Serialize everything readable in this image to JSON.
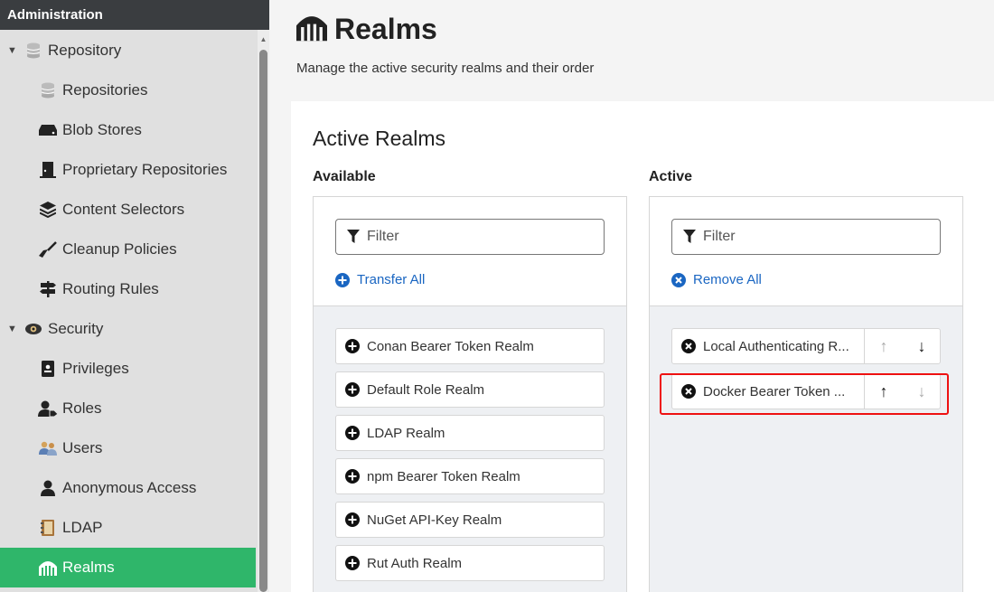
{
  "sidebar": {
    "header": "Administration",
    "repository": {
      "label": "Repository",
      "items": [
        "Repositories",
        "Blob Stores",
        "Proprietary Repositories",
        "Content Selectors",
        "Cleanup Policies",
        "Routing Rules"
      ]
    },
    "security": {
      "label": "Security",
      "items": [
        "Privileges",
        "Roles",
        "Users",
        "Anonymous Access",
        "LDAP",
        "Realms"
      ]
    },
    "selected": "Realms"
  },
  "page": {
    "title": "Realms",
    "subtitle": "Manage the active security realms and their order"
  },
  "card": {
    "title": "Active Realms",
    "available": {
      "label": "Available",
      "filter_placeholder": "Filter",
      "action": "Transfer All",
      "items": [
        "Conan Bearer Token Realm",
        "Default Role Realm",
        "LDAP Realm",
        "npm Bearer Token Realm",
        "NuGet API-Key Realm",
        "Rut Auth Realm"
      ]
    },
    "active": {
      "label": "Active",
      "filter_placeholder": "Filter",
      "action": "Remove All",
      "items": [
        "Local Authenticating R...",
        "Docker Bearer Token ..."
      ]
    }
  },
  "colors": {
    "selected_nav": "#2fb66a",
    "link": "#1a66c2",
    "highlight": "#ee1111"
  }
}
